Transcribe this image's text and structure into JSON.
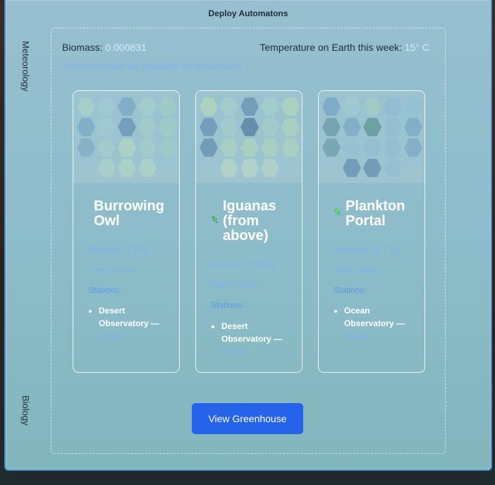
{
  "header": {
    "title": "Deploy Automatons"
  },
  "sidebar": {
    "tabs": [
      {
        "label": "Meteorology"
      },
      {
        "label": "Biology"
      }
    ]
  },
  "stats": {
    "biomass_label": "Biomass:",
    "biomass_value": "0.000831",
    "temperature_label": "Temperature on Earth this week:",
    "temperature_value": "15° C"
  },
  "notice": "Telescope/data are available for observation",
  "cards": [
    {
      "title": "Burrowing Owl",
      "icon": "",
      "biomass": "Biomass: 0.5 kg",
      "type": "Type: Fauna",
      "stations_label": "Stations:",
      "station_name": "Desert Observatory —",
      "station_location": "Desert"
    },
    {
      "title": "Iguanas (from above)",
      "icon": "🦎",
      "biomass": "Biomass: 0.25 kg",
      "type": "Type: Fauna",
      "stations_label": "Stations:",
      "station_name": "Desert Observatory —",
      "station_location": "Desert"
    },
    {
      "title": "Plankton Portal",
      "icon": "🦠",
      "biomass": "Biomass: 1e-7 kg",
      "type": "Type: Fauna",
      "stations_label": "Stations:",
      "station_name": "Ocean Observatory —",
      "station_location": "Ocean"
    }
  ],
  "actions": {
    "view_greenhouse": "View Greenhouse"
  },
  "colors": {
    "accent": "#2563eb",
    "link": "#7fb1ee",
    "panel": "#8cbcc9"
  }
}
